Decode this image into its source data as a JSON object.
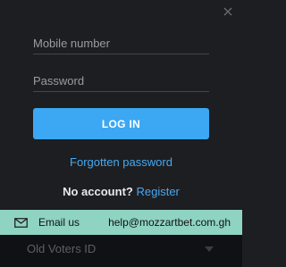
{
  "login": {
    "mobile_placeholder": "Mobile number",
    "password_placeholder": "Password",
    "login_button": "LOG IN",
    "forgot_password": "Forgotten password",
    "no_account": "No account?",
    "register": "Register"
  },
  "contact": {
    "email_label": "Email us",
    "email_address": "help@mozzartbet.com.gh"
  },
  "background_select": {
    "value": "Old Voters ID"
  },
  "icons": {
    "close": "close-icon",
    "mail": "envelope-icon",
    "caret": "chevron-down-icon"
  },
  "colors": {
    "background": "#1d1e21",
    "accent": "#3ca7f2",
    "link": "#45a9f2",
    "contact_bar": "#8fd3c2"
  }
}
